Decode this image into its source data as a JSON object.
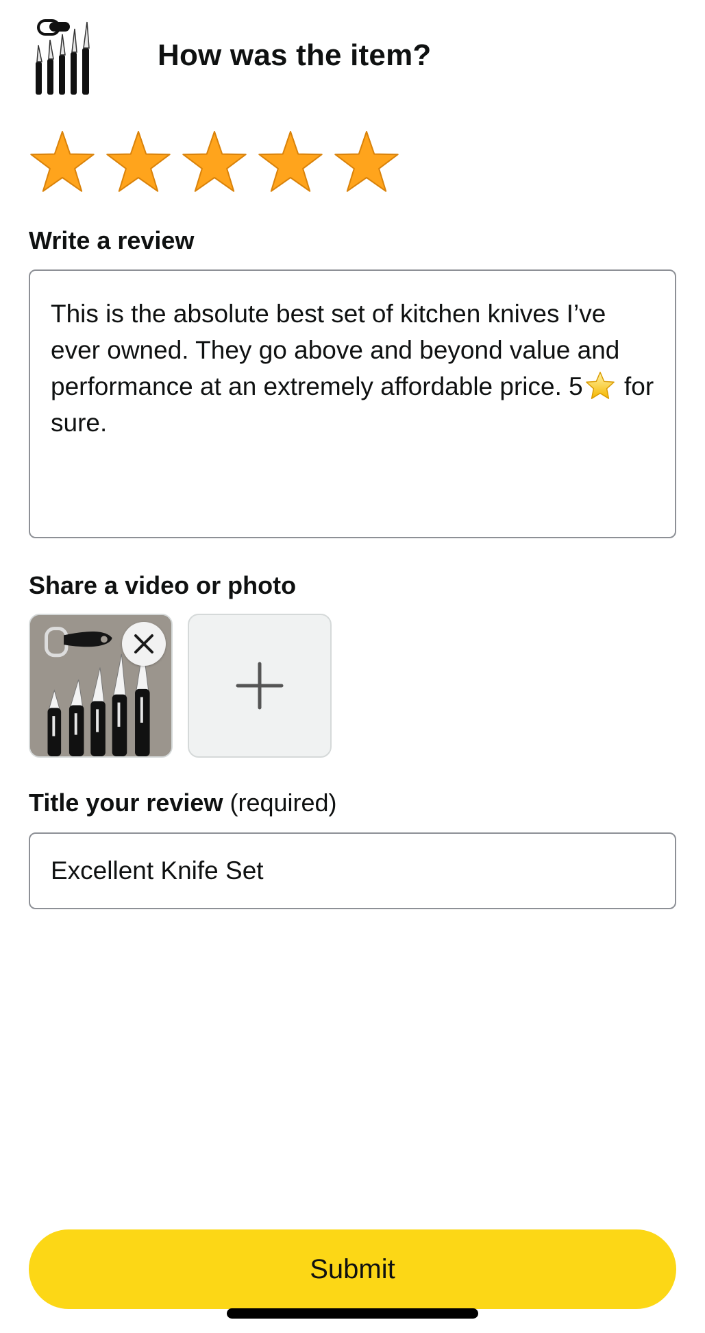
{
  "header": {
    "title": "How was the item?",
    "product_icon": "knife-set-thumbnail"
  },
  "rating": {
    "value": 5,
    "max": 5,
    "star_color": "#ffa41c"
  },
  "review": {
    "label": "Write a review",
    "text_before_emoji": "This is the absolute best set of kitchen knives I’ve ever owned. They go above and beyond value and performance at an extremely affordable price. 5",
    "emoji": "star-emoji-icon",
    "text_after_emoji": " for sure."
  },
  "media": {
    "label": "Share a video or photo",
    "photo_icon": "knife-set-photo",
    "remove_icon": "close-icon",
    "add_icon": "plus-icon"
  },
  "title": {
    "label": "Title your review",
    "label_suffix": "(required)",
    "value": "Excellent Knife Set"
  },
  "submit": {
    "label": "Submit",
    "color": "#fcd716"
  }
}
